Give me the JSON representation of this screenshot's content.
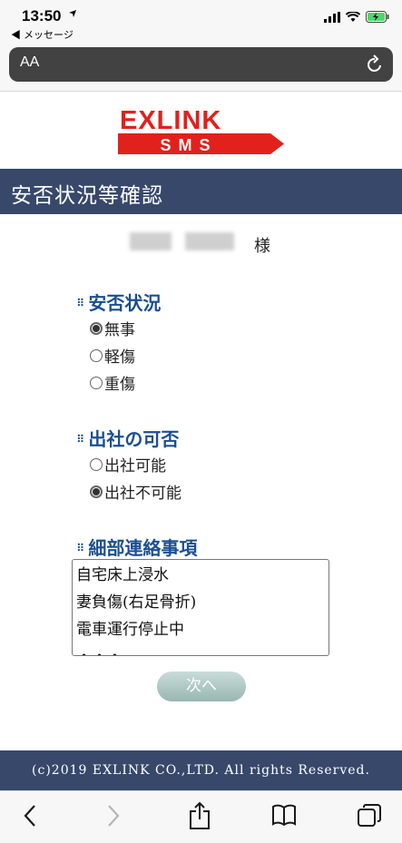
{
  "status": {
    "time": "13:50",
    "back_app": "◀ メッセージ"
  },
  "url_bar": {
    "aa": "AA"
  },
  "logo": {
    "brand": "EXLINK",
    "sub": "SMS"
  },
  "title": "安否状況等確認",
  "greeting": {
    "suffix": "様"
  },
  "safety": {
    "heading": "安否状況",
    "options": [
      "無事",
      "軽傷",
      "重傷"
    ],
    "selected": "無事"
  },
  "attendance": {
    "heading": "出社の可否",
    "options": [
      "出社可能",
      "出社不可能"
    ],
    "selected": "出社不可能"
  },
  "details": {
    "heading": "細部連絡事項",
    "lines": [
      "自宅床上浸水",
      "妻負傷(右足骨折)",
      "電車運行停止中",
      "・・・"
    ]
  },
  "next_button": "次へ",
  "footer": "(c)2019 EXLINK CO.,LTD. All rights Reserved.",
  "colors": {
    "title_band": "#37486b",
    "heading_text": "#1b4f8f",
    "logo_red": "#e2201c"
  },
  "toolbar_icons": [
    "back-icon",
    "forward-icon",
    "share-icon",
    "bookmarks-icon",
    "tabs-icon"
  ]
}
